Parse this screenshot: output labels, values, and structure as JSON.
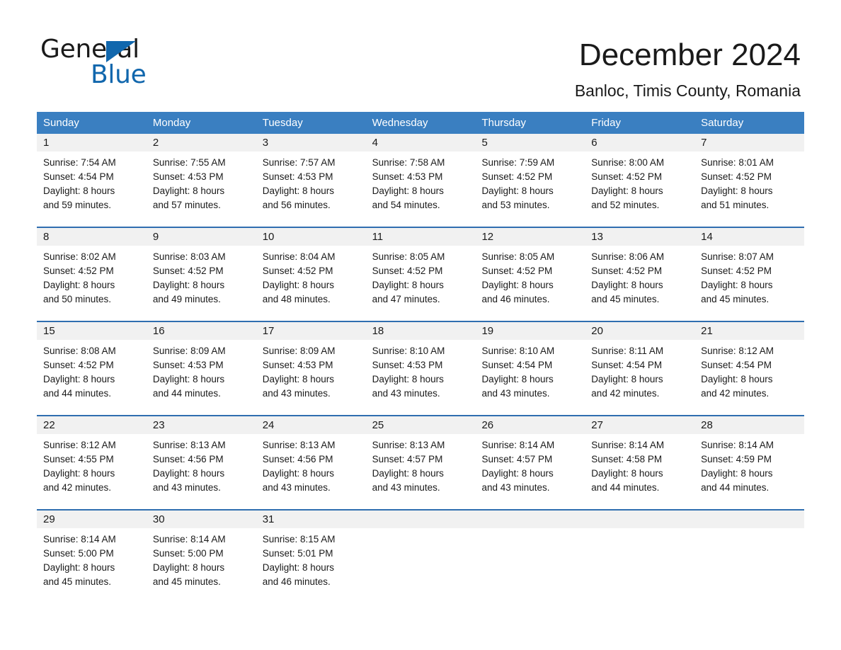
{
  "logo": {
    "word_one": "General",
    "word_two": "Blue",
    "accent_color": "#1167ad",
    "triangle_icon": "logo-triangle-icon"
  },
  "header": {
    "month_title": "December 2024",
    "location": "Banloc, Timis County, Romania"
  },
  "theme": {
    "header_blue": "#3a7fc1",
    "row_border_blue": "#2f6eb0",
    "daynum_gray": "#f1f1f1"
  },
  "weekdays": [
    "Sunday",
    "Monday",
    "Tuesday",
    "Wednesday",
    "Thursday",
    "Friday",
    "Saturday"
  ],
  "weeks": [
    [
      {
        "day": "1",
        "sunrise": "Sunrise: 7:54 AM",
        "sunset": "Sunset: 4:54 PM",
        "daylight_line1": "Daylight: 8 hours",
        "daylight_line2": "and 59 minutes."
      },
      {
        "day": "2",
        "sunrise": "Sunrise: 7:55 AM",
        "sunset": "Sunset: 4:53 PM",
        "daylight_line1": "Daylight: 8 hours",
        "daylight_line2": "and 57 minutes."
      },
      {
        "day": "3",
        "sunrise": "Sunrise: 7:57 AM",
        "sunset": "Sunset: 4:53 PM",
        "daylight_line1": "Daylight: 8 hours",
        "daylight_line2": "and 56 minutes."
      },
      {
        "day": "4",
        "sunrise": "Sunrise: 7:58 AM",
        "sunset": "Sunset: 4:53 PM",
        "daylight_line1": "Daylight: 8 hours",
        "daylight_line2": "and 54 minutes."
      },
      {
        "day": "5",
        "sunrise": "Sunrise: 7:59 AM",
        "sunset": "Sunset: 4:52 PM",
        "daylight_line1": "Daylight: 8 hours",
        "daylight_line2": "and 53 minutes."
      },
      {
        "day": "6",
        "sunrise": "Sunrise: 8:00 AM",
        "sunset": "Sunset: 4:52 PM",
        "daylight_line1": "Daylight: 8 hours",
        "daylight_line2": "and 52 minutes."
      },
      {
        "day": "7",
        "sunrise": "Sunrise: 8:01 AM",
        "sunset": "Sunset: 4:52 PM",
        "daylight_line1": "Daylight: 8 hours",
        "daylight_line2": "and 51 minutes."
      }
    ],
    [
      {
        "day": "8",
        "sunrise": "Sunrise: 8:02 AM",
        "sunset": "Sunset: 4:52 PM",
        "daylight_line1": "Daylight: 8 hours",
        "daylight_line2": "and 50 minutes."
      },
      {
        "day": "9",
        "sunrise": "Sunrise: 8:03 AM",
        "sunset": "Sunset: 4:52 PM",
        "daylight_line1": "Daylight: 8 hours",
        "daylight_line2": "and 49 minutes."
      },
      {
        "day": "10",
        "sunrise": "Sunrise: 8:04 AM",
        "sunset": "Sunset: 4:52 PM",
        "daylight_line1": "Daylight: 8 hours",
        "daylight_line2": "and 48 minutes."
      },
      {
        "day": "11",
        "sunrise": "Sunrise: 8:05 AM",
        "sunset": "Sunset: 4:52 PM",
        "daylight_line1": "Daylight: 8 hours",
        "daylight_line2": "and 47 minutes."
      },
      {
        "day": "12",
        "sunrise": "Sunrise: 8:05 AM",
        "sunset": "Sunset: 4:52 PM",
        "daylight_line1": "Daylight: 8 hours",
        "daylight_line2": "and 46 minutes."
      },
      {
        "day": "13",
        "sunrise": "Sunrise: 8:06 AM",
        "sunset": "Sunset: 4:52 PM",
        "daylight_line1": "Daylight: 8 hours",
        "daylight_line2": "and 45 minutes."
      },
      {
        "day": "14",
        "sunrise": "Sunrise: 8:07 AM",
        "sunset": "Sunset: 4:52 PM",
        "daylight_line1": "Daylight: 8 hours",
        "daylight_line2": "and 45 minutes."
      }
    ],
    [
      {
        "day": "15",
        "sunrise": "Sunrise: 8:08 AM",
        "sunset": "Sunset: 4:52 PM",
        "daylight_line1": "Daylight: 8 hours",
        "daylight_line2": "and 44 minutes."
      },
      {
        "day": "16",
        "sunrise": "Sunrise: 8:09 AM",
        "sunset": "Sunset: 4:53 PM",
        "daylight_line1": "Daylight: 8 hours",
        "daylight_line2": "and 44 minutes."
      },
      {
        "day": "17",
        "sunrise": "Sunrise: 8:09 AM",
        "sunset": "Sunset: 4:53 PM",
        "daylight_line1": "Daylight: 8 hours",
        "daylight_line2": "and 43 minutes."
      },
      {
        "day": "18",
        "sunrise": "Sunrise: 8:10 AM",
        "sunset": "Sunset: 4:53 PM",
        "daylight_line1": "Daylight: 8 hours",
        "daylight_line2": "and 43 minutes."
      },
      {
        "day": "19",
        "sunrise": "Sunrise: 8:10 AM",
        "sunset": "Sunset: 4:54 PM",
        "daylight_line1": "Daylight: 8 hours",
        "daylight_line2": "and 43 minutes."
      },
      {
        "day": "20",
        "sunrise": "Sunrise: 8:11 AM",
        "sunset": "Sunset: 4:54 PM",
        "daylight_line1": "Daylight: 8 hours",
        "daylight_line2": "and 42 minutes."
      },
      {
        "day": "21",
        "sunrise": "Sunrise: 8:12 AM",
        "sunset": "Sunset: 4:54 PM",
        "daylight_line1": "Daylight: 8 hours",
        "daylight_line2": "and 42 minutes."
      }
    ],
    [
      {
        "day": "22",
        "sunrise": "Sunrise: 8:12 AM",
        "sunset": "Sunset: 4:55 PM",
        "daylight_line1": "Daylight: 8 hours",
        "daylight_line2": "and 42 minutes."
      },
      {
        "day": "23",
        "sunrise": "Sunrise: 8:13 AM",
        "sunset": "Sunset: 4:56 PM",
        "daylight_line1": "Daylight: 8 hours",
        "daylight_line2": "and 43 minutes."
      },
      {
        "day": "24",
        "sunrise": "Sunrise: 8:13 AM",
        "sunset": "Sunset: 4:56 PM",
        "daylight_line1": "Daylight: 8 hours",
        "daylight_line2": "and 43 minutes."
      },
      {
        "day": "25",
        "sunrise": "Sunrise: 8:13 AM",
        "sunset": "Sunset: 4:57 PM",
        "daylight_line1": "Daylight: 8 hours",
        "daylight_line2": "and 43 minutes."
      },
      {
        "day": "26",
        "sunrise": "Sunrise: 8:14 AM",
        "sunset": "Sunset: 4:57 PM",
        "daylight_line1": "Daylight: 8 hours",
        "daylight_line2": "and 43 minutes."
      },
      {
        "day": "27",
        "sunrise": "Sunrise: 8:14 AM",
        "sunset": "Sunset: 4:58 PM",
        "daylight_line1": "Daylight: 8 hours",
        "daylight_line2": "and 44 minutes."
      },
      {
        "day": "28",
        "sunrise": "Sunrise: 8:14 AM",
        "sunset": "Sunset: 4:59 PM",
        "daylight_line1": "Daylight: 8 hours",
        "daylight_line2": "and 44 minutes."
      }
    ],
    [
      {
        "day": "29",
        "sunrise": "Sunrise: 8:14 AM",
        "sunset": "Sunset: 5:00 PM",
        "daylight_line1": "Daylight: 8 hours",
        "daylight_line2": "and 45 minutes."
      },
      {
        "day": "30",
        "sunrise": "Sunrise: 8:14 AM",
        "sunset": "Sunset: 5:00 PM",
        "daylight_line1": "Daylight: 8 hours",
        "daylight_line2": "and 45 minutes."
      },
      {
        "day": "31",
        "sunrise": "Sunrise: 8:15 AM",
        "sunset": "Sunset: 5:01 PM",
        "daylight_line1": "Daylight: 8 hours",
        "daylight_line2": "and 46 minutes."
      },
      {
        "day": "",
        "sunrise": "",
        "sunset": "",
        "daylight_line1": "",
        "daylight_line2": ""
      },
      {
        "day": "",
        "sunrise": "",
        "sunset": "",
        "daylight_line1": "",
        "daylight_line2": ""
      },
      {
        "day": "",
        "sunrise": "",
        "sunset": "",
        "daylight_line1": "",
        "daylight_line2": ""
      },
      {
        "day": "",
        "sunrise": "",
        "sunset": "",
        "daylight_line1": "",
        "daylight_line2": ""
      }
    ]
  ]
}
